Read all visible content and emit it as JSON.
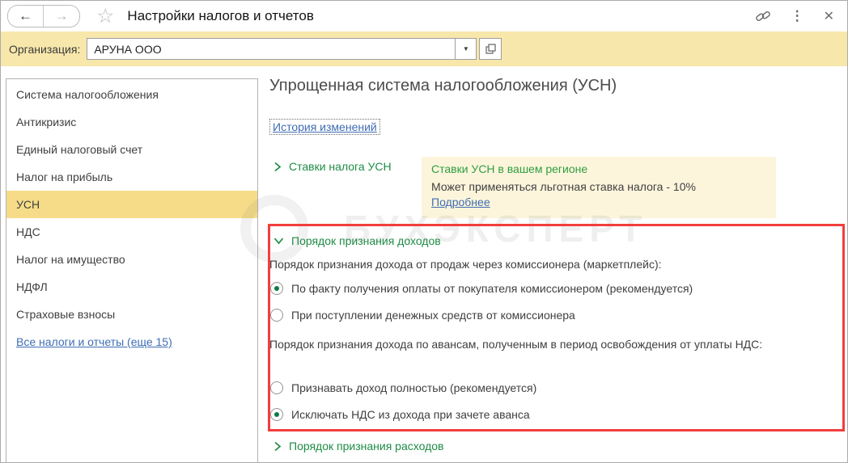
{
  "colors": {
    "accent-green": "#1e8c45",
    "info-green": "#2f9e41",
    "radio-green": "#0d7c43",
    "link-blue": "#3f6db3",
    "highlight-red": "#f23d3d",
    "bar-yellow": "#f8e7ab",
    "selection-yellow": "#f6dc88",
    "info-yellow": "#fcf5dc",
    "text-main": "#3f3f3f"
  },
  "icons": {
    "back": "←",
    "forward": "→",
    "favorite": "☆",
    "more": "⋮",
    "close": "✕",
    "dropdown": "▼"
  },
  "titlebar": {
    "title": "Настройки налогов и отчетов"
  },
  "org_bar": {
    "label": "Организация:",
    "value": "АРУНА ООО"
  },
  "sidebar": {
    "items": [
      {
        "label": "Система налогообложения",
        "selected": false
      },
      {
        "label": "Антикризис",
        "selected": false
      },
      {
        "label": "Единый налоговый счет",
        "selected": false
      },
      {
        "label": "Налог на прибыль",
        "selected": false
      },
      {
        "label": "УСН",
        "selected": true
      },
      {
        "label": "НДС",
        "selected": false
      },
      {
        "label": "Налог на имущество",
        "selected": false
      },
      {
        "label": "НДФЛ",
        "selected": false
      },
      {
        "label": "Страховые взносы",
        "selected": false
      },
      {
        "label": "Все налоги и отчеты (еще 15)",
        "selected": false
      }
    ]
  },
  "main": {
    "heading": "Упрощенная система налогообложения (УСН)",
    "history_link": "История изменений",
    "rates_group": {
      "label": "Ставки налога УСН",
      "expanded": false,
      "info": {
        "title": "Ставки УСН в вашем регионе",
        "text": "Может применяться льготная ставка налога - 10%",
        "link": "Подробнее"
      }
    },
    "income_group": {
      "label": "Порядок признания доходов",
      "expanded": true,
      "q1": "Порядок признания дохода от продаж через комиссионера (маркетплейс):",
      "q1_options": [
        {
          "label": "По факту получения оплаты от покупателя комиссионером (рекомендуется)",
          "selected": true
        },
        {
          "label": "При поступлении денежных средств от комиссионера",
          "selected": false
        }
      ],
      "q2": "Порядок признания дохода по авансам, полученным в период освобождения от уплаты НДС:",
      "q2_options": [
        {
          "label": "Признавать доход полностью (рекомендуется)",
          "selected": false
        },
        {
          "label": "Исключать НДС из дохода при зачете аванса",
          "selected": true
        }
      ]
    },
    "expenses_group": {
      "label": "Порядок признания расходов",
      "expanded": false
    }
  },
  "watermark": "БУХЭКСПЕРТ"
}
